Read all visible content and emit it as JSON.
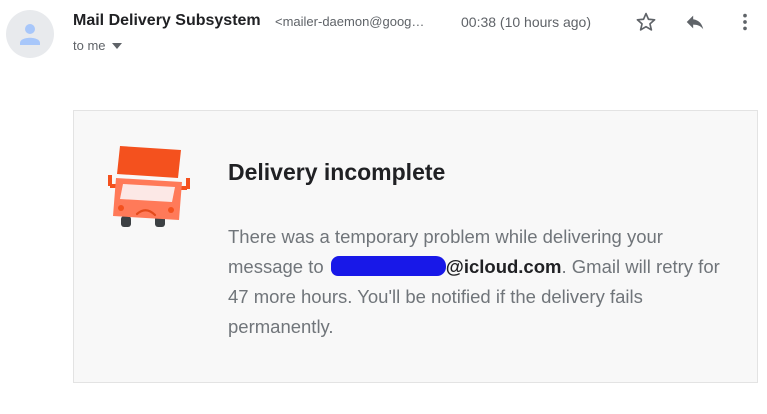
{
  "email": {
    "sender_name": "Mail Delivery Subsystem",
    "sender_email": "<mailer-daemon@goog…",
    "timestamp": "00:38 (10 hours ago)",
    "recipient_label": "to me"
  },
  "actions": {
    "star_icon": "star-icon",
    "reply_icon": "reply-icon",
    "more_icon": "more-vert-icon"
  },
  "notice": {
    "title": "Delivery incomplete",
    "body_part1": "There was a temporary problem while delivering your message to ",
    "recipient_domain": "@icloud.com",
    "body_part2": ". Gmail will retry for 47 more hours. You'll be notified if the delivery fails permanently."
  },
  "colors": {
    "truck_red": "#f4511e",
    "truck_body": "#ff7a59",
    "redaction_blue": "#1818e8",
    "card_bg": "#f8f8f8"
  }
}
